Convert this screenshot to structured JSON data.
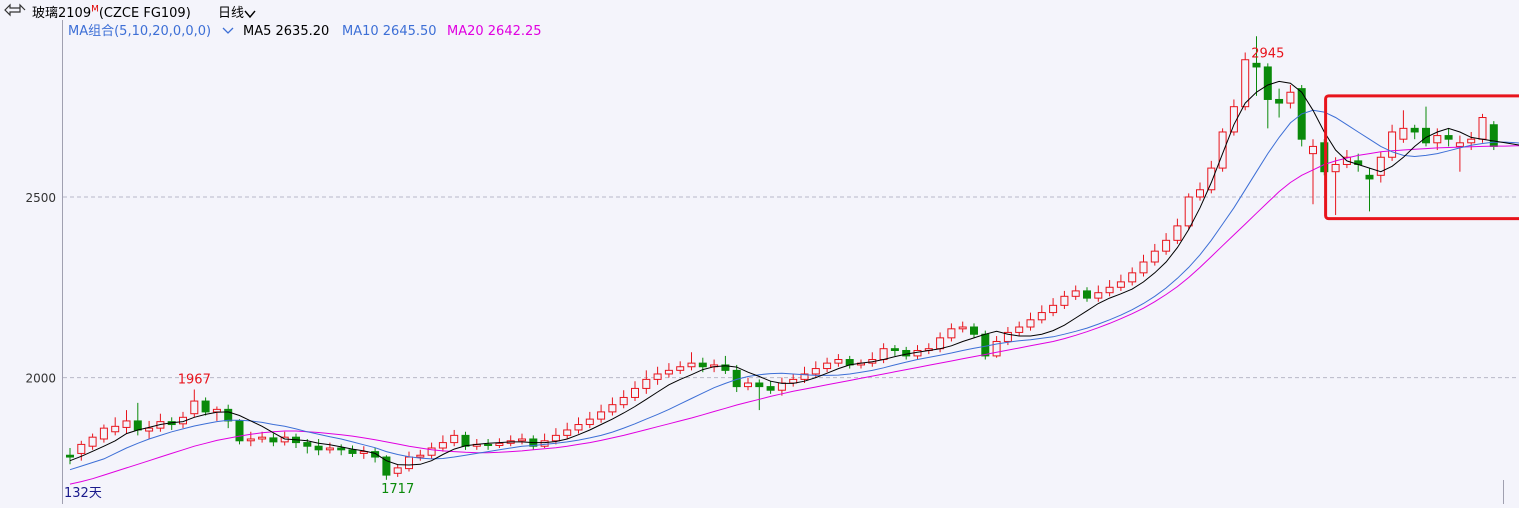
{
  "header": {
    "instrument": "玻璃2109",
    "flag": "M",
    "code": "(CZCE FG109)",
    "period": "日线"
  },
  "indicator": {
    "name": "MA组合(5,10,20,0,0,0)",
    "ma5_label": "MA5 2635.20",
    "ma10_label": "MA10 2645.50",
    "ma20_label": "MA20 2642.25",
    "colors": {
      "ma5": "#000000",
      "ma10": "#3d6fd6",
      "ma20": "#e000e0"
    }
  },
  "chart_data": {
    "type": "candlestick",
    "ylim": [
      1650,
      2990
    ],
    "y_ticks": [
      2000,
      2500
    ],
    "grid": "dashed horizontal",
    "days_label": "132天",
    "annotations": [
      {
        "label": "1967",
        "index": 11
      },
      {
        "label": "1717",
        "index": 29
      },
      {
        "label": "2945",
        "index": 106
      }
    ],
    "highlight": {
      "from_index": 112,
      "to_index": 131,
      "y_range": [
        2440,
        2780
      ],
      "color": "#e8141c"
    },
    "colors": {
      "up": "#e8141c",
      "down": "#0a8a0a"
    },
    "candles": [
      [
        1785,
        1780,
        1805,
        1760
      ],
      [
        1790,
        1815,
        1825,
        1770
      ],
      [
        1810,
        1835,
        1845,
        1800
      ],
      [
        1830,
        1860,
        1870,
        1820
      ],
      [
        1850,
        1865,
        1890,
        1840
      ],
      [
        1862,
        1880,
        1910,
        1845
      ],
      [
        1880,
        1855,
        1930,
        1840
      ],
      [
        1852,
        1860,
        1880,
        1830
      ],
      [
        1860,
        1878,
        1900,
        1850
      ],
      [
        1878,
        1870,
        1890,
        1855
      ],
      [
        1872,
        1890,
        1905,
        1860
      ],
      [
        1900,
        1935,
        1967,
        1890
      ],
      [
        1935,
        1905,
        1945,
        1895
      ],
      [
        1905,
        1912,
        1920,
        1880
      ],
      [
        1912,
        1880,
        1925,
        1860
      ],
      [
        1880,
        1825,
        1885,
        1815
      ],
      [
        1825,
        1830,
        1850,
        1810
      ],
      [
        1830,
        1835,
        1850,
        1820
      ],
      [
        1833,
        1822,
        1845,
        1810
      ],
      [
        1822,
        1835,
        1850,
        1812
      ],
      [
        1835,
        1820,
        1845,
        1805
      ],
      [
        1820,
        1810,
        1830,
        1790
      ],
      [
        1810,
        1800,
        1830,
        1785
      ],
      [
        1800,
        1805,
        1820,
        1790
      ],
      [
        1805,
        1800,
        1815,
        1785
      ],
      [
        1800,
        1790,
        1812,
        1780
      ],
      [
        1790,
        1795,
        1810,
        1775
      ],
      [
        1795,
        1780,
        1805,
        1765
      ],
      [
        1780,
        1730,
        1785,
        1717
      ],
      [
        1735,
        1750,
        1760,
        1725
      ],
      [
        1748,
        1780,
        1795,
        1740
      ],
      [
        1780,
        1785,
        1800,
        1770
      ],
      [
        1785,
        1805,
        1820,
        1775
      ],
      [
        1805,
        1820,
        1840,
        1795
      ],
      [
        1820,
        1840,
        1855,
        1810
      ],
      [
        1840,
        1810,
        1850,
        1800
      ],
      [
        1810,
        1815,
        1830,
        1800
      ],
      [
        1815,
        1812,
        1830,
        1800
      ],
      [
        1812,
        1818,
        1832,
        1805
      ],
      [
        1818,
        1825,
        1840,
        1810
      ],
      [
        1825,
        1830,
        1845,
        1815
      ],
      [
        1830,
        1810,
        1840,
        1800
      ],
      [
        1810,
        1825,
        1845,
        1805
      ],
      [
        1825,
        1840,
        1860,
        1815
      ],
      [
        1840,
        1855,
        1875,
        1830
      ],
      [
        1855,
        1870,
        1890,
        1845
      ],
      [
        1870,
        1885,
        1905,
        1860
      ],
      [
        1885,
        1905,
        1925,
        1875
      ],
      [
        1905,
        1925,
        1945,
        1895
      ],
      [
        1925,
        1945,
        1965,
        1915
      ],
      [
        1945,
        1970,
        1990,
        1935
      ],
      [
        1970,
        1995,
        2020,
        1955
      ],
      [
        1995,
        2010,
        2030,
        1980
      ],
      [
        2010,
        2020,
        2040,
        2000
      ],
      [
        2020,
        2030,
        2045,
        2010
      ],
      [
        2030,
        2040,
        2070,
        2020
      ],
      [
        2040,
        2030,
        2055,
        2015
      ],
      [
        2030,
        2035,
        2050,
        2015
      ],
      [
        2035,
        2020,
        2060,
        2010
      ],
      [
        2020,
        1975,
        2035,
        1960
      ],
      [
        1975,
        1985,
        2000,
        1965
      ],
      [
        1985,
        1975,
        1995,
        1910
      ],
      [
        1975,
        1965,
        1990,
        1955
      ],
      [
        1965,
        1985,
        2000,
        1950
      ],
      [
        1985,
        1995,
        2010,
        1975
      ],
      [
        1995,
        2010,
        2030,
        1985
      ],
      [
        2010,
        2025,
        2045,
        2000
      ],
      [
        2025,
        2040,
        2055,
        2015
      ],
      [
        2040,
        2050,
        2065,
        2030
      ],
      [
        2050,
        2035,
        2060,
        2025
      ],
      [
        2035,
        2040,
        2050,
        2025
      ],
      [
        2040,
        2050,
        2070,
        2030
      ],
      [
        2050,
        2080,
        2095,
        2040
      ],
      [
        2080,
        2075,
        2090,
        2060
      ],
      [
        2075,
        2060,
        2085,
        2050
      ],
      [
        2060,
        2075,
        2090,
        2050
      ],
      [
        2075,
        2080,
        2095,
        2065
      ],
      [
        2080,
        2110,
        2125,
        2070
      ],
      [
        2110,
        2135,
        2150,
        2100
      ],
      [
        2135,
        2140,
        2155,
        2125
      ],
      [
        2140,
        2120,
        2150,
        2110
      ],
      [
        2120,
        2060,
        2130,
        2050
      ],
      [
        2060,
        2100,
        2115,
        2055
      ],
      [
        2100,
        2125,
        2140,
        2090
      ],
      [
        2125,
        2140,
        2155,
        2115
      ],
      [
        2140,
        2160,
        2180,
        2130
      ],
      [
        2160,
        2180,
        2200,
        2150
      ],
      [
        2180,
        2200,
        2220,
        2170
      ],
      [
        2200,
        2225,
        2240,
        2190
      ],
      [
        2225,
        2240,
        2255,
        2215
      ],
      [
        2240,
        2220,
        2250,
        2210
      ],
      [
        2220,
        2235,
        2255,
        2210
      ],
      [
        2235,
        2250,
        2270,
        2225
      ],
      [
        2250,
        2265,
        2285,
        2240
      ],
      [
        2265,
        2290,
        2305,
        2255
      ],
      [
        2290,
        2320,
        2340,
        2280
      ],
      [
        2320,
        2350,
        2370,
        2310
      ],
      [
        2350,
        2380,
        2400,
        2340
      ],
      [
        2380,
        2420,
        2440,
        2370
      ],
      [
        2420,
        2500,
        2510,
        2410
      ],
      [
        2500,
        2520,
        2540,
        2490
      ],
      [
        2520,
        2580,
        2600,
        2510
      ],
      [
        2580,
        2680,
        2690,
        2570
      ],
      [
        2680,
        2750,
        2770,
        2670
      ],
      [
        2750,
        2880,
        2900,
        2740
      ],
      [
        2870,
        2860,
        2945,
        2780
      ],
      [
        2860,
        2770,
        2870,
        2690
      ],
      [
        2770,
        2760,
        2800,
        2720
      ],
      [
        2760,
        2790,
        2810,
        2745
      ],
      [
        2800,
        2660,
        2810,
        2640
      ],
      [
        2620,
        2640,
        2660,
        2480
      ],
      [
        2650,
        2570,
        2660,
        2560
      ],
      [
        2570,
        2590,
        2610,
        2450
      ],
      [
        2590,
        2610,
        2630,
        2580
      ],
      [
        2600,
        2590,
        2620,
        2570
      ],
      [
        2560,
        2550,
        2580,
        2460
      ],
      [
        2560,
        2610,
        2625,
        2540
      ],
      [
        2610,
        2680,
        2700,
        2600
      ],
      [
        2660,
        2690,
        2740,
        2650
      ],
      [
        2690,
        2680,
        2700,
        2660
      ],
      [
        2690,
        2650,
        2750,
        2640
      ],
      [
        2650,
        2670,
        2690,
        2630
      ],
      [
        2670,
        2660,
        2690,
        2640
      ],
      [
        2640,
        2650,
        2670,
        2570
      ],
      [
        2650,
        2660,
        2680,
        2630
      ],
      [
        2660,
        2720,
        2730,
        2650
      ],
      [
        2700,
        2640,
        2710,
        2630
      ]
    ],
    "ma5": [
      1770,
      1782,
      1796,
      1810,
      1825,
      1845,
      1855,
      1862,
      1870,
      1875,
      1878,
      1890,
      1898,
      1904,
      1905,
      1895,
      1880,
      1865,
      1847,
      1830,
      1828,
      1825,
      1818,
      1814,
      1808,
      1802,
      1797,
      1790,
      1770,
      1759,
      1758,
      1760,
      1770,
      1787,
      1802,
      1811,
      1815,
      1818,
      1820,
      1822,
      1822,
      1820,
      1820,
      1823,
      1830,
      1842,
      1855,
      1870,
      1885,
      1902,
      1920,
      1940,
      1960,
      1980,
      1995,
      2008,
      2022,
      2030,
      2033,
      2029,
      2015,
      2003,
      1990,
      1984,
      1984,
      1990,
      2000,
      2012,
      2025,
      2035,
      2040,
      2044,
      2050,
      2058,
      2065,
      2070,
      2075,
      2080,
      2088,
      2100,
      2110,
      2120,
      2128,
      2120,
      2115,
      2115,
      2120,
      2130,
      2145,
      2165,
      2185,
      2205,
      2220,
      2232,
      2245,
      2265,
      2290,
      2320,
      2360,
      2410,
      2470,
      2540,
      2620,
      2700,
      2760,
      2790,
      2810,
      2820,
      2815,
      2790,
      2740,
      2680,
      2630,
      2600,
      2590,
      2580,
      2570,
      2585,
      2610,
      2640,
      2665,
      2680,
      2690,
      2680,
      2665,
      2660,
      2655,
      2650,
      2645,
      2640,
      2635
    ],
    "ma10": [
      1745,
      1755,
      1765,
      1775,
      1790,
      1805,
      1818,
      1830,
      1840,
      1850,
      1858,
      1866,
      1872,
      1878,
      1882,
      1882,
      1880,
      1876,
      1870,
      1865,
      1858,
      1850,
      1843,
      1836,
      1830,
      1822,
      1814,
      1806,
      1795,
      1787,
      1781,
      1777,
      1775,
      1776,
      1780,
      1785,
      1790,
      1795,
      1800,
      1805,
      1810,
      1812,
      1815,
      1818,
      1822,
      1827,
      1833,
      1840,
      1849,
      1860,
      1872,
      1885,
      1898,
      1912,
      1927,
      1942,
      1957,
      1972,
      1984,
      1995,
      2003,
      2008,
      2011,
      2012,
      2010,
      2008,
      2006,
      2006,
      2007,
      2010,
      2015,
      2020,
      2027,
      2035,
      2043,
      2050,
      2056,
      2062,
      2068,
      2075,
      2081,
      2087,
      2093,
      2098,
      2102,
      2105,
      2109,
      2113,
      2120,
      2128,
      2137,
      2148,
      2160,
      2173,
      2188,
      2205,
      2225,
      2248,
      2275,
      2305,
      2340,
      2380,
      2425,
      2470,
      2520,
      2570,
      2620,
      2665,
      2705,
      2730,
      2740,
      2735,
      2720,
      2700,
      2680,
      2660,
      2640,
      2625,
      2615,
      2612,
      2615,
      2620,
      2628,
      2636,
      2643,
      2648,
      2652,
      2652,
      2650,
      2648,
      2646
    ],
    "ma20": [
      1705,
      1712,
      1720,
      1730,
      1740,
      1750,
      1760,
      1770,
      1780,
      1790,
      1800,
      1810,
      1818,
      1826,
      1832,
      1838,
      1843,
      1847,
      1850,
      1852,
      1852,
      1850,
      1848,
      1845,
      1842,
      1838,
      1833,
      1828,
      1822,
      1816,
      1810,
      1805,
      1800,
      1797,
      1795,
      1793,
      1792,
      1792,
      1793,
      1795,
      1797,
      1800,
      1803,
      1806,
      1810,
      1815,
      1820,
      1826,
      1833,
      1840,
      1848,
      1856,
      1864,
      1872,
      1880,
      1888,
      1897,
      1906,
      1915,
      1924,
      1932,
      1940,
      1948,
      1955,
      1962,
      1968,
      1974,
      1980,
      1986,
      1992,
      1998,
      2004,
      2010,
      2016,
      2022,
      2028,
      2034,
      2040,
      2046,
      2052,
      2058,
      2064,
      2070,
      2076,
      2082,
      2088,
      2094,
      2100,
      2108,
      2117,
      2127,
      2138,
      2150,
      2163,
      2177,
      2192,
      2210,
      2230,
      2252,
      2277,
      2305,
      2335,
      2365,
      2395,
      2425,
      2455,
      2485,
      2515,
      2540,
      2560,
      2575,
      2590,
      2600,
      2608,
      2615,
      2620,
      2625,
      2628,
      2630,
      2632,
      2634,
      2636,
      2637,
      2638,
      2639,
      2640,
      2641,
      2641,
      2642,
      2642,
      2642
    ]
  }
}
